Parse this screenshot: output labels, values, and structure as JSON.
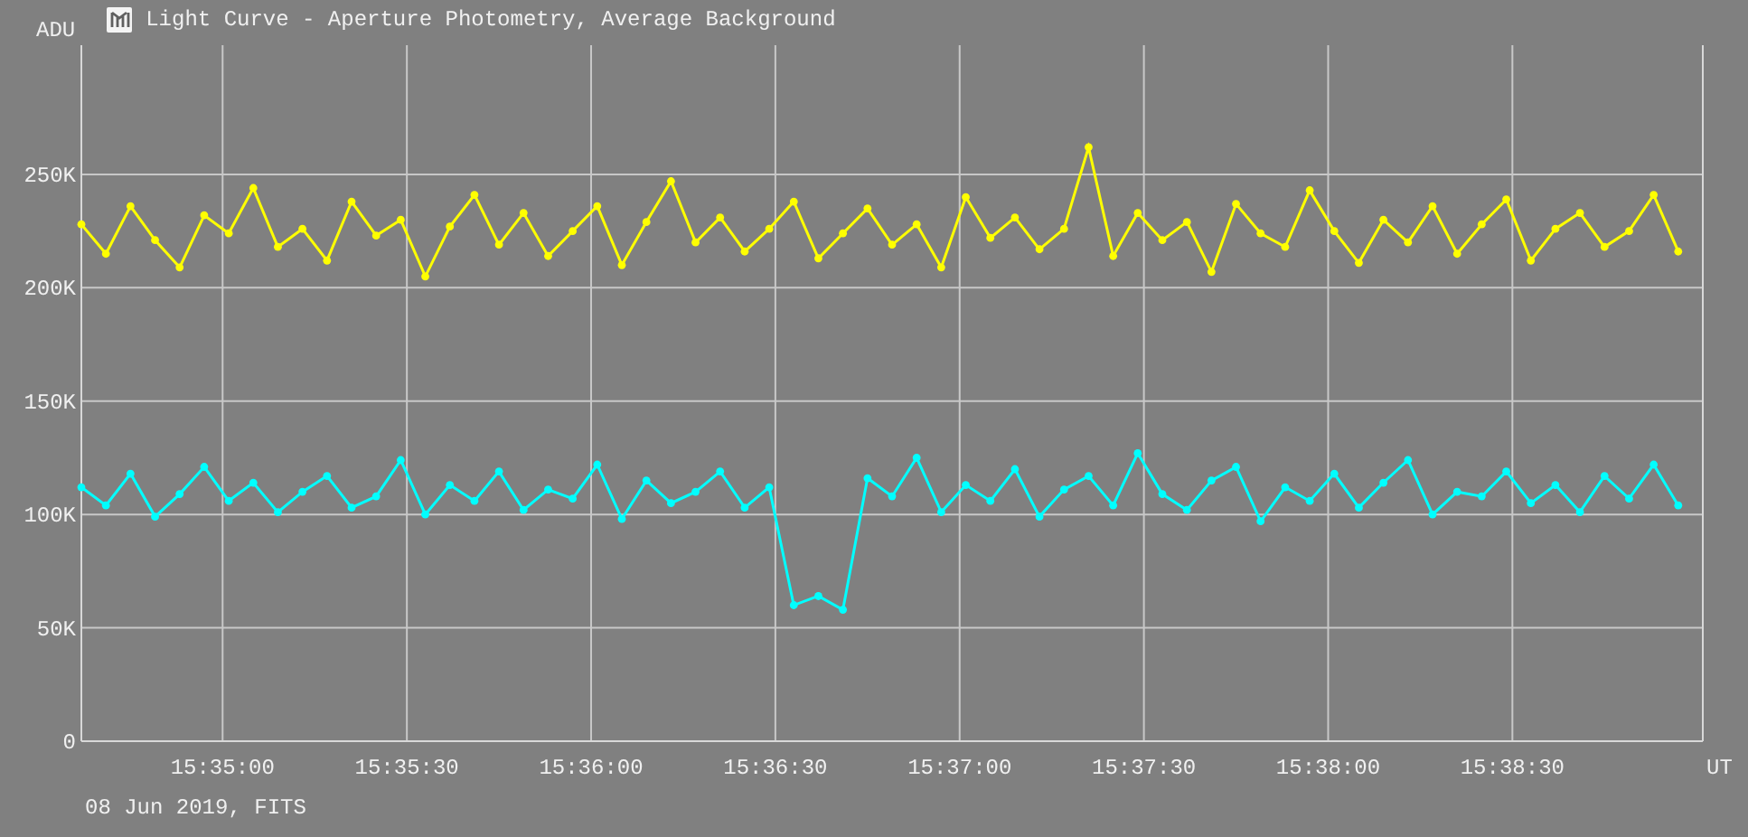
{
  "window": {
    "title": "Light Curve - Aperture Photometry, Average Background"
  },
  "chart_data": {
    "type": "line",
    "grid": true,
    "xlabel": "UT",
    "ylabel": "ADU",
    "xlim": [
      56077,
      56341
    ],
    "ylim": [
      0,
      307
    ],
    "x": [
      56077,
      56081,
      56085,
      56089,
      56093,
      56097,
      56101,
      56105,
      56109,
      56113,
      56117,
      56121,
      56125,
      56129,
      56133,
      56137,
      56141,
      56145,
      56149,
      56153,
      56157,
      56161,
      56165,
      56169,
      56173,
      56177,
      56181,
      56185,
      56189,
      56193,
      56197,
      56201,
      56205,
      56209,
      56213,
      56217,
      56221,
      56225,
      56229,
      56233,
      56237,
      56241,
      56245,
      56249,
      56253,
      56257,
      56261,
      56265,
      56269,
      56273,
      56277,
      56281,
      56285,
      56289,
      56293,
      56297,
      56301,
      56305,
      56309,
      56313,
      56317,
      56321,
      56325,
      56329,
      56333,
      56337
    ],
    "series": [
      {
        "color": "#ffff00",
        "marker": "circle",
        "values": [
          228,
          215,
          236,
          221,
          209,
          232,
          224,
          244,
          218,
          226,
          212,
          238,
          223,
          230,
          205,
          227,
          241,
          219,
          233,
          214,
          225,
          236,
          210,
          229,
          247,
          220,
          231,
          216,
          226,
          238,
          213,
          224,
          235,
          219,
          228,
          209,
          240,
          222,
          231,
          217,
          226,
          262,
          214,
          233,
          221,
          229,
          207,
          237,
          224,
          218,
          243,
          225,
          211,
          230,
          220,
          236,
          215,
          228,
          239,
          212,
          226,
          233,
          218,
          225,
          241,
          216
        ]
      },
      {
        "color": "#00ffff",
        "marker": "circle",
        "values": [
          112,
          104,
          118,
          99,
          109,
          121,
          106,
          114,
          101,
          110,
          117,
          103,
          108,
          124,
          100,
          113,
          106,
          119,
          102,
          111,
          107,
          122,
          98,
          115,
          105,
          110,
          119,
          103,
          112,
          60,
          64,
          58,
          116,
          108,
          125,
          101,
          113,
          106,
          120,
          99,
          111,
          117,
          104,
          127,
          109,
          102,
          115,
          121,
          97,
          112,
          106,
          118,
          103,
          114,
          124,
          100,
          110,
          108,
          119,
          105,
          113,
          101,
          117,
          107,
          122,
          104
        ]
      }
    ],
    "xticks": [
      {
        "value": 56100,
        "label": "15:35:00"
      },
      {
        "value": 56130,
        "label": "15:35:30"
      },
      {
        "value": 56160,
        "label": "15:36:00"
      },
      {
        "value": 56190,
        "label": "15:36:30"
      },
      {
        "value": 56220,
        "label": "15:37:00"
      },
      {
        "value": 56250,
        "label": "15:37:30"
      },
      {
        "value": 56280,
        "label": "15:38:00"
      },
      {
        "value": 56310,
        "label": "15:38:30"
      }
    ],
    "yticks": [
      {
        "value": 0,
        "label": "0"
      },
      {
        "value": 50,
        "label": "50K"
      },
      {
        "value": 100,
        "label": "100K"
      },
      {
        "value": 150,
        "label": "150K"
      },
      {
        "value": 200,
        "label": "200K"
      },
      {
        "value": 250,
        "label": "250K"
      }
    ]
  },
  "footer": "08 Jun 2019, FITS"
}
